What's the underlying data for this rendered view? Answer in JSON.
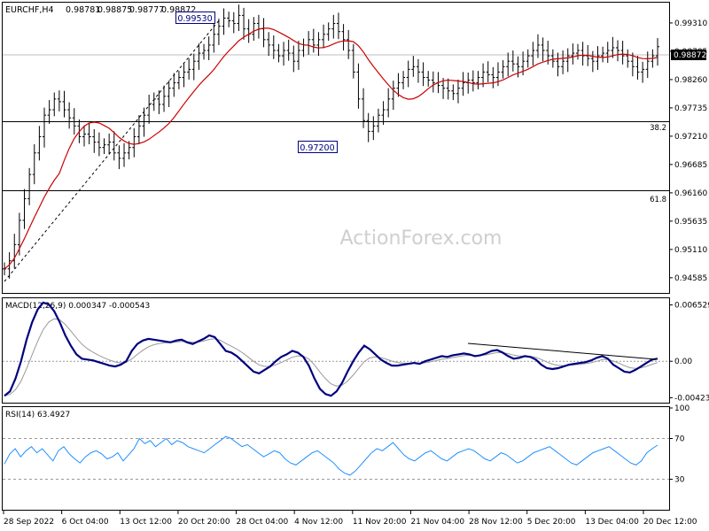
{
  "chart_data": {
    "type": "candlestick",
    "symbol_info": {
      "label": "EURCHF,H4",
      "open": "0.98781",
      "high": "0.98875",
      "low": "0.98777",
      "close": "0.98872"
    },
    "watermark": "ActionForex.com",
    "price_axis": {
      "ticks": [
        "0.99310",
        "0.98785",
        "0.98260",
        "0.97735",
        "0.97210",
        "0.96685",
        "0.96160",
        "0.95635",
        "0.95110",
        "0.94585"
      ],
      "current_price": "0.98872",
      "range": [
        0.9432,
        0.9967
      ]
    },
    "annotations": {
      "high_label": "0.99530",
      "low_label": "0.97200",
      "fib_382_label": "38.2",
      "fib_382_level": 0.9748,
      "fib_618_label": "61.8",
      "fib_618_level": 0.962
    },
    "price_series": {
      "name": "EURCHF H4 close",
      "values": [
        0.9475,
        0.949,
        0.952,
        0.9565,
        0.9605,
        0.965,
        0.969,
        0.972,
        0.976,
        0.977,
        0.979,
        0.9785,
        0.977,
        0.9755,
        0.974,
        0.972,
        0.9725,
        0.972,
        0.971,
        0.97,
        0.9705,
        0.971,
        0.969,
        0.968,
        0.969,
        0.97,
        0.972,
        0.974,
        0.976,
        0.978,
        0.979,
        0.978,
        0.9795,
        0.981,
        0.982,
        0.983,
        0.984,
        0.9845,
        0.986,
        0.9875,
        0.988,
        0.989,
        0.991,
        0.9925,
        0.994,
        0.9935,
        0.993,
        0.9945,
        0.992,
        0.991,
        0.993,
        0.992,
        0.99,
        0.989,
        0.988,
        0.987,
        0.988,
        0.9875,
        0.986,
        0.988,
        0.989,
        0.99,
        0.989,
        0.99,
        0.991,
        0.992,
        0.993,
        0.9915,
        0.99,
        0.988,
        0.984,
        0.979,
        0.975,
        0.973,
        0.974,
        0.976,
        0.977,
        0.979,
        0.981,
        0.982,
        0.983,
        0.9845,
        0.985,
        0.984,
        0.983,
        0.9825,
        0.982,
        0.9815,
        0.981,
        0.9805,
        0.98,
        0.981,
        0.982,
        0.9825,
        0.982,
        0.983,
        0.984,
        0.9835,
        0.983,
        0.984,
        0.985,
        0.986,
        0.9855,
        0.985,
        0.986,
        0.987,
        0.988,
        0.989,
        0.988,
        0.987,
        0.986,
        0.985,
        0.986,
        0.987,
        0.9875,
        0.988,
        0.987,
        0.9865,
        0.986,
        0.987,
        0.9875,
        0.988,
        0.9885,
        0.988,
        0.987,
        0.986,
        0.985,
        0.984,
        0.9845,
        0.986,
        0.987,
        0.9887
      ]
    },
    "moving_average": {
      "color": "#cc0000"
    },
    "x_axis": {
      "labels": [
        "28 Sep 2022",
        "6 Oct 04:00",
        "13 Oct 12:00",
        "20 Oct 20:00",
        "28 Oct 04:00",
        "4 Nov 12:00",
        "11 Nov 20:00",
        "21 Nov 04:00",
        "28 Nov 12:00",
        "5 Dec 20:00",
        "13 Dec 04:00",
        "20 Dec 12:00"
      ]
    },
    "macd": {
      "label": "MACD(12,26,9) 0.000347 -0.000543",
      "ticks": [
        "0.006529",
        "0.00",
        "-0.004233"
      ],
      "range": [
        -0.0048,
        0.0072
      ],
      "values": [
        -0.004,
        -0.0035,
        -0.002,
        0.0,
        0.0025,
        0.0045,
        0.006,
        0.0068,
        0.0066,
        0.0058,
        0.0045,
        0.003,
        0.0018,
        0.0008,
        0.0003,
        0.0002,
        0.0001,
        -0.0001,
        -0.0003,
        -0.0005,
        -0.0006,
        -0.0004,
        0.0,
        0.0012,
        0.002,
        0.0024,
        0.0026,
        0.0025,
        0.0024,
        0.0023,
        0.0022,
        0.0024,
        0.0025,
        0.0022,
        0.002,
        0.0023,
        0.0026,
        0.003,
        0.0028,
        0.002,
        0.0012,
        0.001,
        0.0006,
        0.0,
        -0.0006,
        -0.0012,
        -0.0014,
        -0.001,
        -0.0006,
        0.0,
        0.0005,
        0.0008,
        0.0012,
        0.001,
        0.0005,
        -0.0005,
        -0.002,
        -0.0032,
        -0.0038,
        -0.004,
        -0.0035,
        -0.0025,
        -0.0012,
        0.0,
        0.001,
        0.0018,
        0.0014,
        0.0008,
        0.0002,
        -0.0002,
        -0.0005,
        -0.0005,
        -0.0004,
        -0.0003,
        -0.0002,
        -0.0003,
        0.0,
        0.0002,
        0.0004,
        0.0006,
        0.0005,
        0.0007,
        0.0008,
        0.0009,
        0.0008,
        0.0006,
        0.0007,
        0.0009,
        0.0012,
        0.0013,
        0.001,
        0.0006,
        0.0003,
        0.0004,
        0.0006,
        0.0005,
        0.0002,
        -0.0004,
        -0.0008,
        -0.0009,
        -0.0008,
        -0.0006,
        -0.0004,
        -0.0003,
        -0.0002,
        -0.0001,
        0.0001,
        0.0004,
        0.0006,
        0.0003,
        -0.0004,
        -0.0008,
        -0.0012,
        -0.0013,
        -0.001,
        -0.0006,
        -0.0002,
        0.0002,
        0.0003
      ]
    },
    "rsi": {
      "label": "RSI(14) 63.4927",
      "ticks": [
        "100",
        "70",
        "30"
      ],
      "range": [
        0,
        100
      ],
      "values": [
        45,
        55,
        60,
        52,
        58,
        62,
        56,
        60,
        54,
        48,
        58,
        62,
        55,
        50,
        46,
        52,
        56,
        58,
        55,
        50,
        52,
        56,
        48,
        54,
        60,
        70,
        65,
        68,
        62,
        66,
        70,
        64,
        68,
        66,
        62,
        60,
        58,
        56,
        60,
        64,
        68,
        72,
        70,
        66,
        62,
        64,
        60,
        56,
        52,
        55,
        58,
        56,
        50,
        46,
        44,
        48,
        52,
        56,
        58,
        54,
        50,
        46,
        40,
        36,
        34,
        38,
        44,
        50,
        56,
        60,
        58,
        62,
        66,
        60,
        54,
        50,
        48,
        52,
        56,
        58,
        54,
        50,
        48,
        52,
        56,
        58,
        60,
        58,
        54,
        50,
        48,
        52,
        56,
        54,
        50,
        46,
        48,
        52,
        56,
        58,
        60,
        62,
        58,
        54,
        50,
        46,
        44,
        48,
        52,
        56,
        58,
        60,
        62,
        58,
        54,
        50,
        46,
        44,
        48,
        56,
        60,
        63.5
      ]
    },
    "colors": {
      "candles": "#000000",
      "ma": "#cc0000",
      "macd_line": "#000080",
      "signal_line": "#999999",
      "rsi_line": "#1e90ff",
      "grid_dash": "#999999"
    }
  }
}
